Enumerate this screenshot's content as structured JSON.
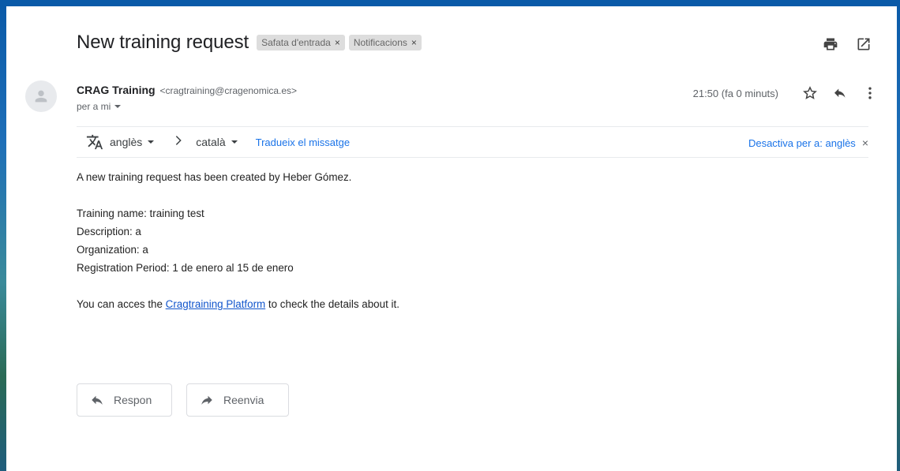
{
  "message": {
    "subject": "New training request",
    "labels": [
      {
        "text": "Safata d'entrada",
        "close": "×"
      },
      {
        "text": "Notificacions",
        "close": "×"
      }
    ],
    "sender_name": "CRAG Training",
    "sender_email": "<cragtraining@cragenomica.es>",
    "recipient": "per a mi",
    "timestamp": "21:50 (fa 0 minuts)"
  },
  "translate": {
    "from": "anglès",
    "to": "català",
    "action": "Tradueix el missatge",
    "disable": "Desactiva per a: anglès",
    "close": "×"
  },
  "body": {
    "line1": "A new training request has been created by Heber Gómez.",
    "training_name": "Training name: training test",
    "description": "Description: a",
    "organization": "Organization: a",
    "registration": "Registration Period: 1 de enero al 15 de enero",
    "link_prefix": "You can acces the ",
    "link_text": "Cragtraining Platform",
    "link_suffix": " to check the details about it."
  },
  "actions": {
    "reply": "Respon",
    "forward": "Reenvia"
  },
  "icons": [
    "print-icon",
    "open-in-new-icon",
    "star-icon",
    "reply-icon",
    "more-vert-icon",
    "translate-icon",
    "chevron-right-icon",
    "forward-icon",
    "avatar-person-icon",
    "dropdown-caret-icon"
  ]
}
